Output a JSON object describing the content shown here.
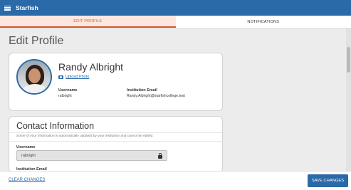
{
  "app": {
    "title": "Starfish"
  },
  "tabs": [
    {
      "label": "EDIT PROFILE"
    },
    {
      "label": "NOTIFICATIONS"
    }
  ],
  "page": {
    "title": "Edit Profile"
  },
  "profile": {
    "name": "Randy Albright",
    "upload_label": "Upload Photo",
    "username_label": "Username",
    "username_value": "ralbright",
    "email_label": "Institution Email",
    "email_value": "Randy.Albright@starfishcollege.test"
  },
  "contact": {
    "title": "Contact Information",
    "note": "Some of your information is automatically updated by your institution and cannot be edited.",
    "username_label": "Username",
    "username_value": "ralbright",
    "email_label": "Institution Email"
  },
  "footer": {
    "clear_label": "CLEAR CHANGES",
    "save_label": "SAVE CHANGES"
  },
  "colors": {
    "brand": "#2a6aa8",
    "active_tab": "#d45a2a"
  },
  "icons": {
    "menu": "hamburger-icon",
    "camera": "camera-icon",
    "lock": "lock-icon"
  }
}
